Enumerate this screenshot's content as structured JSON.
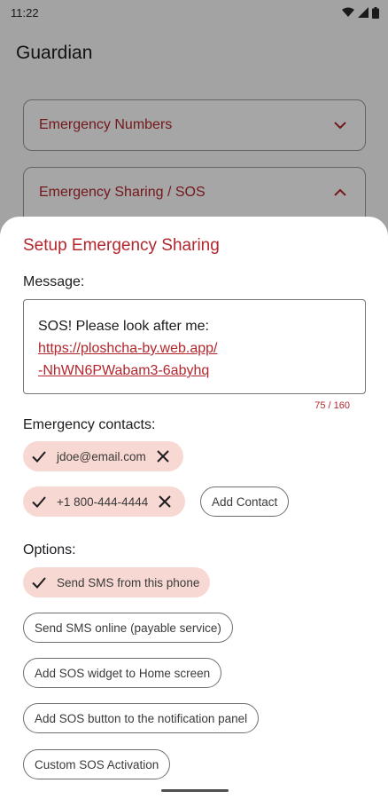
{
  "status_bar": {
    "time": "11:22"
  },
  "app": {
    "title": "Guardian",
    "sections": [
      {
        "title": "Emergency Numbers",
        "expanded": false
      },
      {
        "title": "Emergency Sharing / SOS",
        "expanded": true
      }
    ]
  },
  "sheet": {
    "title": "Setup Emergency Sharing",
    "message_label": "Message:",
    "message": {
      "text": "SOS! Please look after me:",
      "link_line1": "https://ploshcha-by.web.app/",
      "link_line2": "-NhWN6PWabam3-6abyhq"
    },
    "counter": "75 / 160",
    "contacts_label": "Emergency contacts:",
    "contacts": [
      "jdoe@email.com",
      "+1 800-444-4444"
    ],
    "add_contact": "Add Contact",
    "options_label": "Options:",
    "options": [
      {
        "label": "Send SMS from this phone",
        "selected": true
      },
      {
        "label": "Send SMS online (payable service)",
        "selected": false
      },
      {
        "label": "Add SOS widget to Home screen",
        "selected": false
      },
      {
        "label": "Add SOS button to the notification panel",
        "selected": false
      },
      {
        "label": "Custom SOS Activation",
        "selected": false
      }
    ]
  },
  "colors": {
    "accent": "#b3262d",
    "chip_selected": "#f8d8d3"
  }
}
